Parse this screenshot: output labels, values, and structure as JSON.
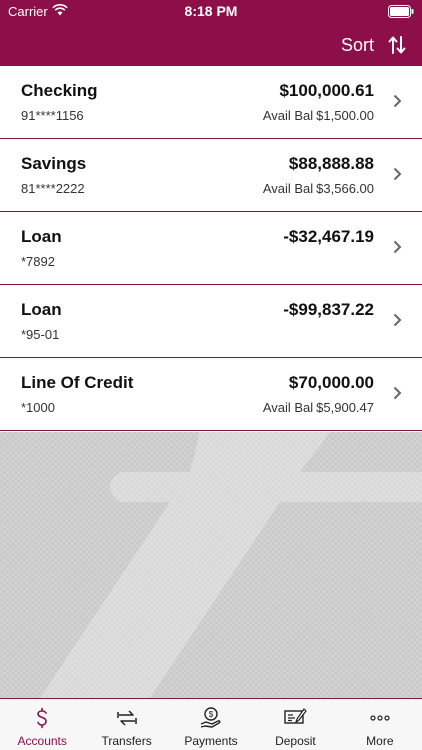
{
  "status_bar": {
    "carrier": "Carrier",
    "time": "8:18 PM"
  },
  "nav": {
    "sort_label": "Sort",
    "sort_icon": "sort-arrows-icon"
  },
  "colors": {
    "brand": "#8c0f4a",
    "background_pattern": "#c9c9c9"
  },
  "accounts": [
    {
      "name": "Checking",
      "number": "91****1156",
      "balance": "$100,000.61",
      "avail_prefix": "Avail Bal",
      "avail": "$1,500.00"
    },
    {
      "name": "Savings",
      "number": "81****2222",
      "balance": "$88,888.88",
      "avail_prefix": "Avail Bal",
      "avail": "$3,566.00"
    },
    {
      "name": "Loan",
      "number": "*7892",
      "balance": "-$32,467.19",
      "avail_prefix": "",
      "avail": ""
    },
    {
      "name": "Loan",
      "number": "*95-01",
      "balance": "-$99,837.22",
      "avail_prefix": "",
      "avail": ""
    },
    {
      "name": "Line Of Credit",
      "number": "*1000",
      "balance": "$70,000.00",
      "avail_prefix": "Avail Bal",
      "avail": "$5,900.47"
    }
  ],
  "tabs": [
    {
      "label": "Accounts",
      "icon": "dollar-icon",
      "active": true
    },
    {
      "label": "Transfers",
      "icon": "transfer-arrows-icon",
      "active": false
    },
    {
      "label": "Payments",
      "icon": "payment-hand-icon",
      "active": false
    },
    {
      "label": "Deposit",
      "icon": "check-deposit-icon",
      "active": false
    },
    {
      "label": "More",
      "icon": "more-dots-icon",
      "active": false
    }
  ]
}
